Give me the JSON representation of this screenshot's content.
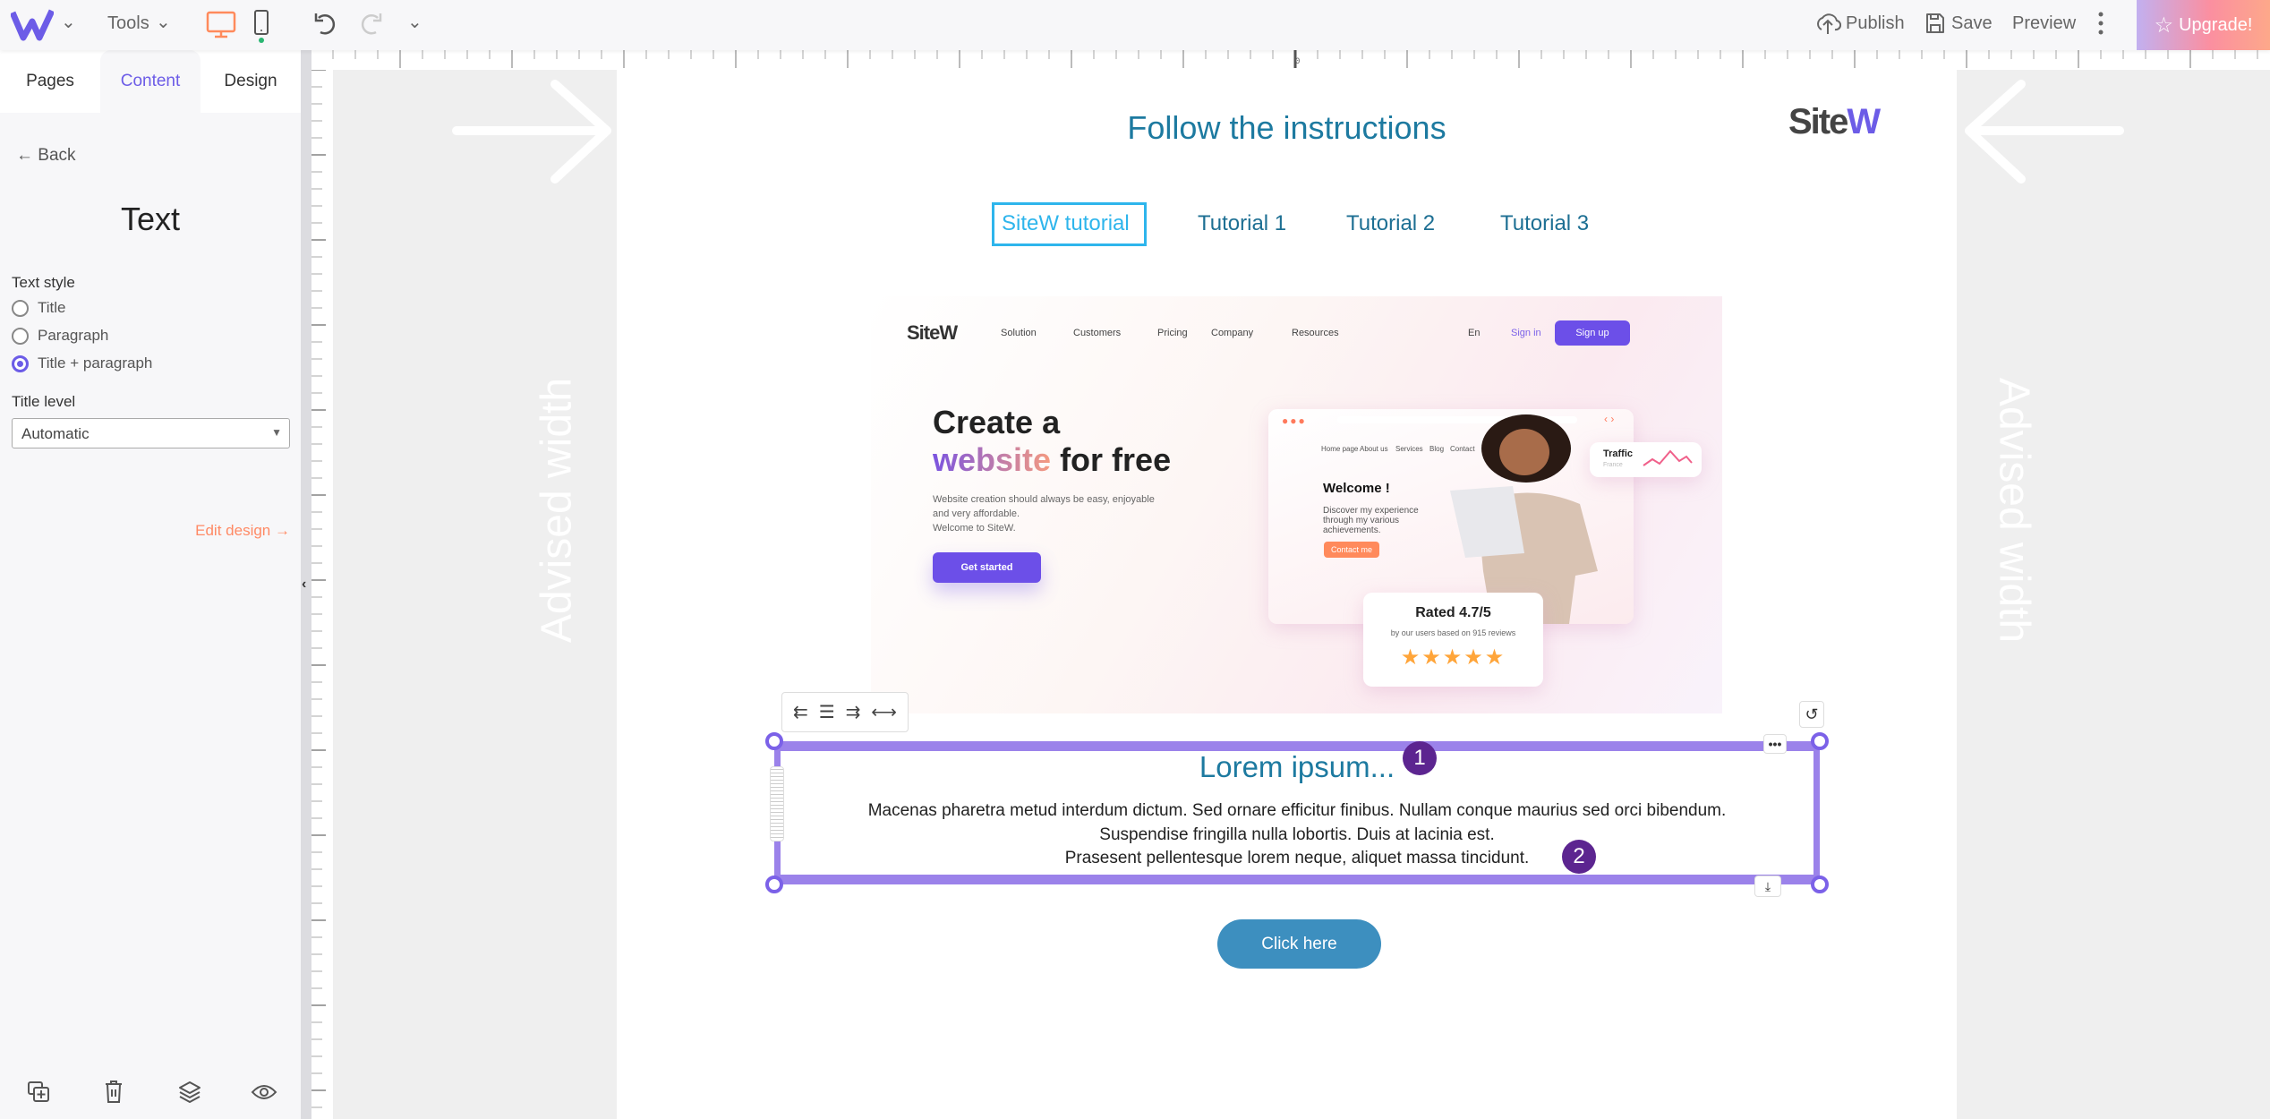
{
  "topbar": {
    "tools": "Tools",
    "publish": "Publish",
    "save": "Save",
    "preview": "Preview",
    "upgrade": "Upgrade!"
  },
  "panel": {
    "tabs": [
      "Pages",
      "Content",
      "Design"
    ],
    "back": "Back",
    "heading": "Text",
    "text_style_label": "Text style",
    "options": [
      "Title",
      "Paragraph",
      "Title + paragraph"
    ],
    "selected_option": "Title + paragraph",
    "title_level_label": "Title level",
    "title_level_value": "Automatic",
    "edit_design": "Edit design"
  },
  "ruler": {
    "zero": "0"
  },
  "canvas": {
    "advised_width": "Advised width",
    "title": "Follow the instructions",
    "tabs": [
      "SiteW tutorial",
      "Tutorial 1",
      "Tutorial 2",
      "Tutorial 3"
    ],
    "active_tab": "SiteW tutorial",
    "hero": {
      "logo": "SiteW",
      "nav": [
        "Solution",
        "Customers",
        "Pricing",
        "Company",
        "Resources"
      ],
      "lang": "En",
      "signin": "Sign in",
      "signup": "Sign up",
      "headline1": "Create a",
      "headline_word": "website",
      "headline2": "for free",
      "sub": [
        "Website creation should always be easy, enjoyable",
        "and very affordable.",
        "Welcome to SiteW."
      ],
      "cta": "Get started",
      "card_nav": [
        "Home page",
        "About us",
        "Services",
        "Blog",
        "Contact"
      ],
      "welcome": "Welcome !",
      "discover": [
        "Discover my experience",
        "through my various",
        "achievements."
      ],
      "contact": "Contact me",
      "traffic": "Traffic",
      "traffic_sub": "France",
      "rated": "Rated 4.7/5",
      "rated_sub": "by our users based on 915 reviews",
      "stars": 5
    },
    "text_block": {
      "title": "Lorem ipsum...",
      "lines": [
        "Macenas pharetra metud interdum dictum. Sed ornare efficitur finibus. Nullam conque maurius sed orci bibendum.",
        "Suspendise fringilla nulla lobortis. Duis at lacinia est.",
        "Prasesent pellentesque lorem neque, aliquet massa tincidunt."
      ],
      "badge1": "1",
      "badge2": "2"
    },
    "button": "Click here"
  },
  "colors": {
    "accent": "#6c5ce7",
    "selection": "#9b82ea",
    "heading": "#1d7aa0",
    "button": "#3d8fbf",
    "badge": "#5c2590",
    "edit_design": "#ff8a65"
  }
}
